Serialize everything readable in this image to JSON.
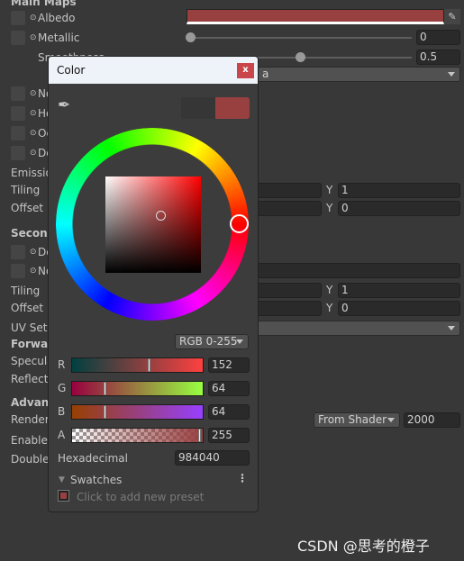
{
  "inspector": {
    "section_main": "Main Maps",
    "albedo": {
      "label": "Albedo",
      "color": "#984040"
    },
    "metallic": {
      "label": "Metallic",
      "value": "0",
      "fraction": 0
    },
    "smoothness": {
      "label": "Smoothness",
      "value": "0.5",
      "fraction": 0.5
    },
    "source_dropdown": "a",
    "normal": "No",
    "height": "He",
    "occlusion": "Oc",
    "detail_mask": "De",
    "emission": "Emissio",
    "tiling": {
      "label": "Tiling",
      "y_label": "Y",
      "y": "1"
    },
    "offset": {
      "label": "Offset",
      "y_label": "Y",
      "y": "0"
    },
    "section_secondary": "Second",
    "detail_albedo": "De",
    "detail_normal": "No",
    "tiling2": {
      "label": "Tiling",
      "y_label": "Y",
      "y": "1"
    },
    "offset2": {
      "label": "Offset",
      "y_label": "Y",
      "y": "0"
    },
    "uv_set": "UV Set",
    "section_forward": "Forwar",
    "specular": "Specula",
    "reflections": "Reflect",
    "section_advanced": "Advanc",
    "render_queue": {
      "label": "Render",
      "dropdown": "From Shader",
      "value": "2000"
    },
    "enable_gpu": "Enable",
    "double_sided": "Double"
  },
  "color_picker": {
    "title": "Color",
    "close_label": "x",
    "previous_color": "#363636",
    "current_color": "#984040",
    "mode": "RGB 0-255",
    "channels": [
      {
        "label": "R",
        "value": "152",
        "fraction": 0.596
      },
      {
        "label": "G",
        "value": "64",
        "fraction": 0.251
      },
      {
        "label": "B",
        "value": "64",
        "fraction": 0.251
      },
      {
        "label": "A",
        "value": "255",
        "fraction": 1
      }
    ],
    "hex_label": "Hexadecimal",
    "hex_value": "984040",
    "swatches_label": "Swatches",
    "preset_hint": "Click to add new preset"
  },
  "watermark": "CSDN @思考的橙子"
}
